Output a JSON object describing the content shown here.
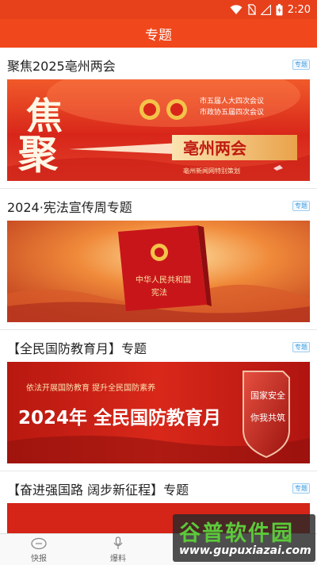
{
  "status_bar": {
    "time": "2:20",
    "icons": [
      "wifi-icon",
      "no-sim-icon",
      "signal-icon",
      "battery-icon"
    ]
  },
  "app_bar": {
    "title": "专题"
  },
  "topics": [
    {
      "title": "聚焦2025亳州两会",
      "tag": "专题",
      "banner": {
        "big_char_1": "聚",
        "big_char_2": "焦",
        "headline": "亳州两会",
        "line1": "市五届人大四次会议",
        "line2": "市政协五届四次会议",
        "caption": "亳州新闻网特别策划"
      }
    },
    {
      "title": "2024·宪法宣传周专题",
      "tag": "专题",
      "banner": {
        "book_line1": "中华人民共和国",
        "book_line2": "宪法"
      }
    },
    {
      "title": "【全民国防教育月】专题",
      "tag": "专题",
      "banner": {
        "slogan": "依法开展国防教育  提升全民国防素养",
        "headline": "2024年 全民国防教育月",
        "shield_left": "国家安全",
        "shield_right": "你我共筑"
      }
    },
    {
      "title": "【奋进强国路 阔步新征程】专题",
      "tag": "专题"
    }
  ],
  "tab_bar": {
    "tabs": [
      {
        "label": "快报",
        "icon": "news-bubble-icon"
      },
      {
        "label": "爆料",
        "icon": "microphone-icon"
      }
    ]
  },
  "watermark": {
    "title": "谷普软件园",
    "url": "www.gupuxiazai.com"
  },
  "colors": {
    "brand": "#f0481c",
    "tag_blue": "#3a9be0"
  }
}
